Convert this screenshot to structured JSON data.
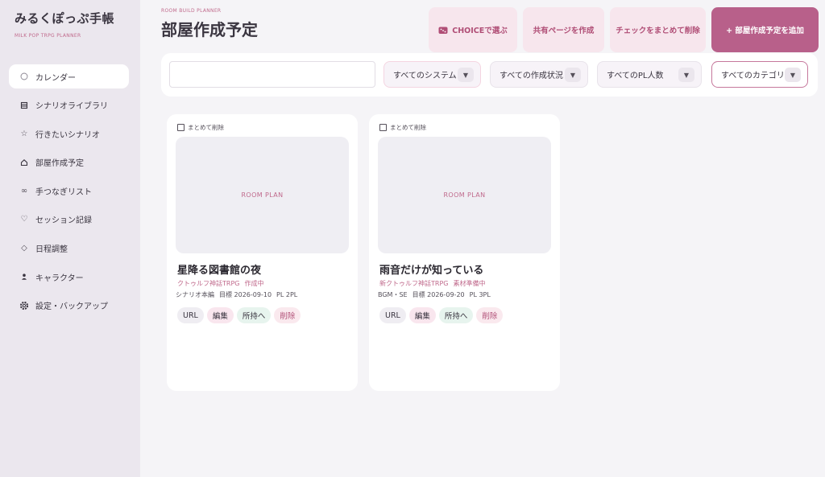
{
  "brand": {
    "title": "みるくぽっぷ手帳",
    "subtitle": "MILK POP TRPG PLANNER"
  },
  "sidebar": {
    "items": [
      {
        "label": "カレンダー",
        "icon": "circle-icon",
        "active": true
      },
      {
        "label": "シナリオライブラリ",
        "icon": "book-icon"
      },
      {
        "label": "行きたいシナリオ",
        "icon": "star-icon"
      },
      {
        "label": "部屋作成予定",
        "icon": "home-icon"
      },
      {
        "label": "手つなぎリスト",
        "icon": "link-icon"
      },
      {
        "label": "セッション記録",
        "icon": "heart-icon"
      },
      {
        "label": "日程調整",
        "icon": "diamond-icon"
      },
      {
        "label": "キャラクター",
        "icon": "person-icon"
      },
      {
        "label": "設定・バックアップ",
        "icon": "gear-icon"
      }
    ]
  },
  "header": {
    "subtitle": "ROOM BUILD PLANNER",
    "title": "部屋作成予定",
    "buttons": {
      "choice": "CHOICEで選ぶ",
      "share": "共有ページを作成",
      "bulk_delete": "チェックをまとめて削除",
      "add": "+ 部屋作成予定を追加"
    }
  },
  "filters": {
    "search_placeholder": "",
    "system": "すべてのシステム",
    "status": "すべての作成状況",
    "pl_count": "すべてのPL人数",
    "category": "すべてのカテゴリ"
  },
  "cards": [
    {
      "check_label": "まとめて削除",
      "thumb_label": "ROOM PLAN",
      "title": "星降る図書館の夜",
      "system": "クトゥルフ神話TRPG",
      "status": "作成中",
      "category": "シナリオ本編",
      "target": "目標 2026-09-10",
      "pl": "PL 2PL",
      "actions": {
        "url": "URL",
        "edit": "編集",
        "own": "所持へ",
        "delete": "削除"
      }
    },
    {
      "check_label": "まとめて削除",
      "thumb_label": "ROOM PLAN",
      "title": "雨音だけが知っている",
      "system": "新クトゥルフ神話TRPG",
      "status": "素材準備中",
      "category": "BGM・SE",
      "target": "目標 2026-09-20",
      "pl": "PL 3PL",
      "actions": {
        "url": "URL",
        "edit": "編集",
        "own": "所持へ",
        "delete": "削除"
      }
    }
  ],
  "colors": {
    "accent": "#b8608a",
    "accent_text": "#c06a8c",
    "sidebar_bg": "#ebe7ee",
    "page_bg": "#f5f4f7"
  }
}
